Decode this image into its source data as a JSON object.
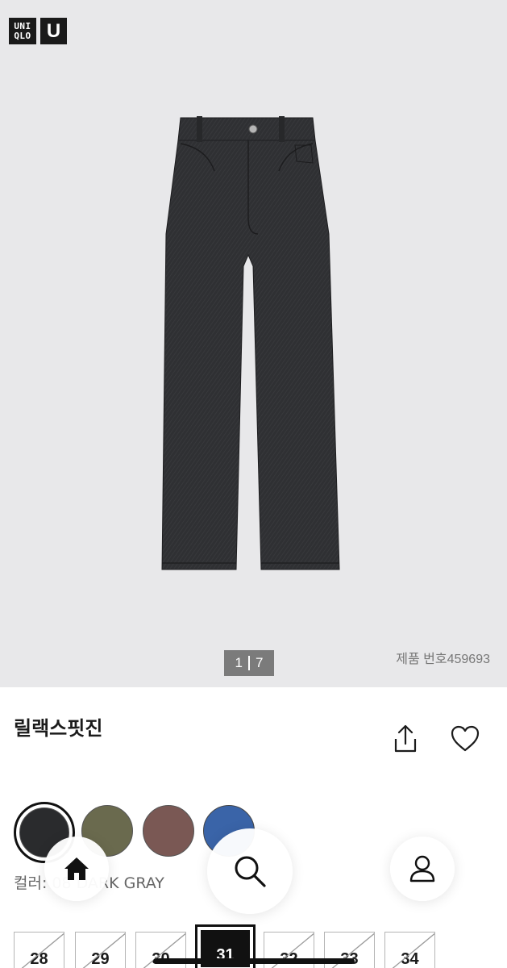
{
  "brand": {
    "logo_line1": "UNI",
    "logo_line2": "QLO",
    "logo_u": "U"
  },
  "gallery": {
    "current": "1",
    "total": "7",
    "product_number": "제품 번호459693"
  },
  "product": {
    "title": "릴랙스핏진"
  },
  "actions": {
    "share_icon": "share-icon",
    "wishlist_icon": "heart-icon"
  },
  "colors": {
    "swatches": [
      {
        "name": "swatch-dark-gray",
        "hex": "#2a2b2d",
        "selected": true
      },
      {
        "name": "swatch-olive",
        "hex": "#6a6a4e",
        "selected": false
      },
      {
        "name": "swatch-brown",
        "hex": "#7a5854",
        "selected": false
      },
      {
        "name": "swatch-blue",
        "hex": "#3a64a8",
        "selected": false
      }
    ],
    "label": "컬러: 08 DARK GRAY"
  },
  "sizes": [
    {
      "label": "28",
      "selected": false
    },
    {
      "label": "29",
      "selected": false
    },
    {
      "label": "30",
      "selected": false
    },
    {
      "label": "31",
      "selected": true
    },
    {
      "label": "32",
      "selected": false
    },
    {
      "label": "33",
      "selected": false
    },
    {
      "label": "34",
      "selected": false
    }
  ],
  "nav": {
    "home_icon": "home-icon",
    "search_icon": "search-icon",
    "account_icon": "user-icon"
  }
}
